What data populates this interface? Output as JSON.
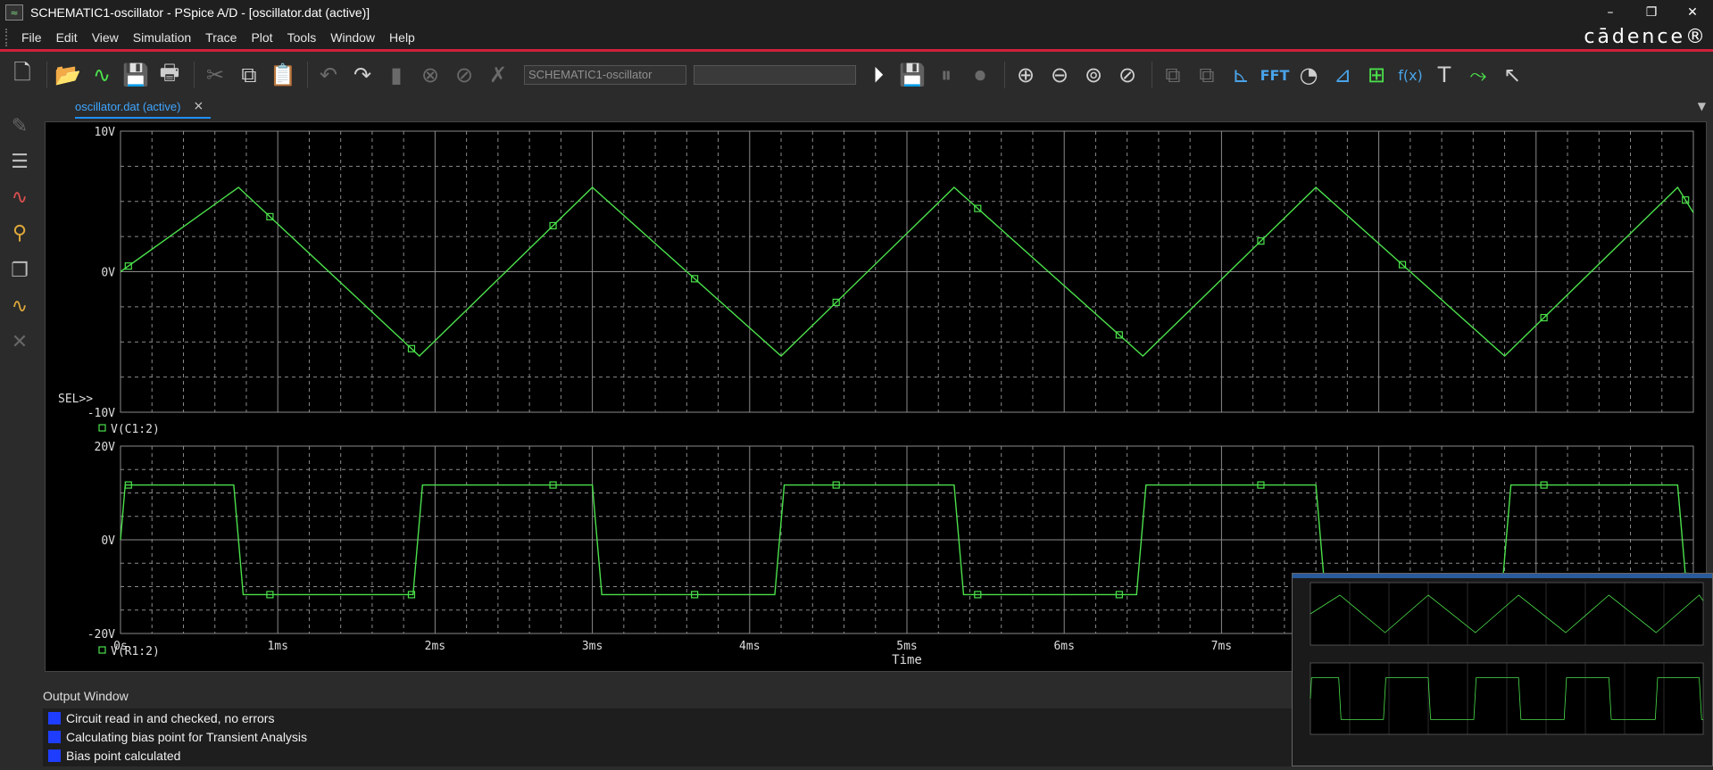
{
  "window": {
    "title": "SCHEMATIC1-oscillator - PSpice A/D  - [oscillator.dat (active)]",
    "app_icon_glyph": "≈",
    "controls": [
      "–",
      "❐",
      "✕"
    ]
  },
  "brand": "cādence®",
  "menu": [
    "File",
    "Edit",
    "View",
    "Simulation",
    "Trace",
    "Plot",
    "Tools",
    "Window",
    "Help"
  ],
  "toolbar": {
    "profile_text": "SCHEMATIC1-oscillator",
    "fft_label": "FFT",
    "fx_label": "f(x)",
    "buttons": [
      {
        "name": "new-file-icon",
        "glyph": "🗋"
      },
      {
        "name": "open-folder-icon",
        "glyph": "📂"
      },
      {
        "name": "open-waveform-icon",
        "glyph": "∿"
      },
      {
        "name": "save-icon",
        "glyph": "💾"
      },
      {
        "name": "print-icon",
        "glyph": "🖶"
      },
      {
        "name": "cut-icon",
        "glyph": "✂"
      },
      {
        "name": "copy-icon",
        "glyph": "⧉"
      },
      {
        "name": "paste-icon",
        "glyph": "📋"
      },
      {
        "name": "undo-icon",
        "glyph": "↶"
      },
      {
        "name": "redo-icon",
        "glyph": "↷"
      }
    ]
  },
  "tab": {
    "label": "oscillator.dat (active)",
    "close": "×",
    "dropdown": "▼"
  },
  "plot": {
    "time_label": "Time",
    "sel_label": "SEL>>",
    "trace_color": "#4be04b",
    "grid_color": "#8a8a8a",
    "x_ticks": [
      "0s",
      "1ms",
      "2ms",
      "3ms",
      "4ms",
      "5ms",
      "6ms",
      "7ms"
    ]
  },
  "chart_data": [
    {
      "type": "line",
      "title": "",
      "xlabel": "Time",
      "ylabel": "",
      "x_unit": "ms",
      "xlim": [
        0,
        10
      ],
      "ylim": [
        -10,
        10
      ],
      "y_ticks": [
        "10V",
        "0V",
        "-10V"
      ],
      "grid": true,
      "legend_position": "bottom-left",
      "series": [
        {
          "name": "V(C1:2)",
          "x": [
            0,
            0.75,
            1.9,
            3.0,
            4.2,
            5.3,
            6.5,
            7.6,
            8.8,
            9.9,
            10.0
          ],
          "values": [
            0.0,
            6.0,
            -6.0,
            6.0,
            -6.0,
            6.0,
            -6.0,
            6.0,
            -6.0,
            6.0,
            4.2
          ]
        }
      ]
    },
    {
      "type": "line",
      "title": "",
      "xlabel": "Time",
      "ylabel": "",
      "x_unit": "ms",
      "xlim": [
        0,
        10
      ],
      "ylim": [
        -20,
        20
      ],
      "y_ticks": [
        "20V",
        "0V",
        "-20V"
      ],
      "grid": true,
      "legend_position": "bottom-left",
      "series": [
        {
          "name": "V(R1:2)",
          "x": [
            0,
            0.03,
            0.72,
            0.78,
            1.86,
            1.92,
            3.0,
            3.06,
            4.16,
            4.22,
            5.3,
            5.36,
            6.46,
            6.52,
            7.6,
            7.66,
            8.78,
            8.84,
            9.9,
            9.96,
            10.0
          ],
          "values": [
            0,
            11.7,
            11.7,
            -11.7,
            -11.7,
            11.7,
            11.7,
            -11.7,
            -11.7,
            11.7,
            11.7,
            -11.7,
            -11.7,
            11.7,
            11.7,
            -11.7,
            -11.7,
            11.7,
            11.7,
            -11.7,
            -11.7
          ]
        }
      ]
    }
  ],
  "output": {
    "title": "Output Window",
    "close": "✕",
    "messages": [
      "Circuit read in and checked, no errors",
      "Calculating bias point for Transient Analysis",
      "Bias point calculated"
    ]
  }
}
